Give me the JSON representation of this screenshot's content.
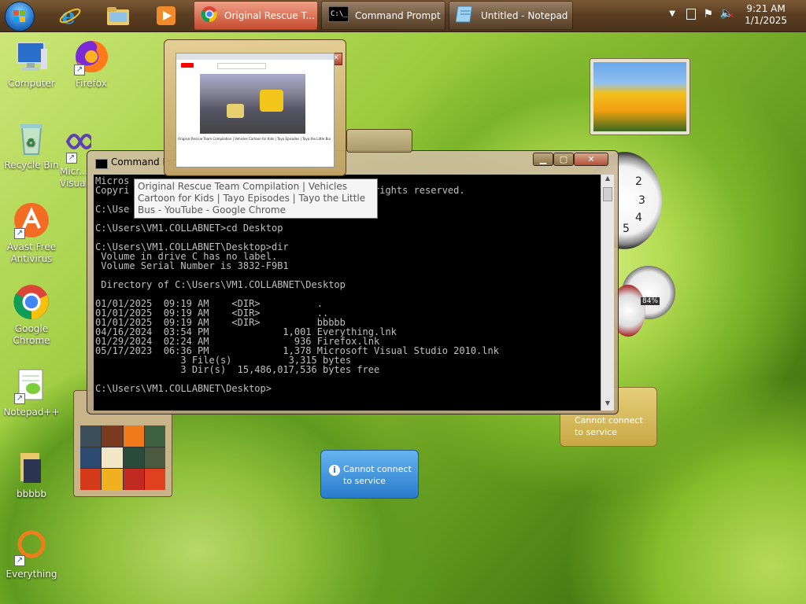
{
  "taskbar": {
    "tasks": [
      {
        "label": "Original Rescue T...",
        "icon": "chrome-icon",
        "active": true
      },
      {
        "label": "Command Prompt",
        "icon": "cmd-icon"
      },
      {
        "label": "Untitled - Notepad",
        "icon": "notepad-icon"
      }
    ],
    "clock": {
      "time": "9:21 AM",
      "date": "1/1/2025"
    }
  },
  "desktop_icons": [
    {
      "label": "Computer",
      "icon": "computer-icon"
    },
    {
      "label": "Firefox",
      "icon": "firefox-icon"
    },
    {
      "label": "Recycle Bin",
      "icon": "recycle-bin-icon"
    },
    {
      "label": "Micr... Visua...",
      "icon": "visual-studio-icon"
    },
    {
      "label": "Avast Free Antivirus",
      "icon": "avast-icon"
    },
    {
      "label": "Google Chrome",
      "icon": "chrome-icon"
    },
    {
      "label": "Notepad++",
      "icon": "notepadpp-icon"
    },
    {
      "label": "bbbbb",
      "icon": "folder-icon"
    },
    {
      "label": "Everything",
      "icon": "everything-icon"
    }
  ],
  "cmd_window": {
    "title": "Command Prompt",
    "lines": [
      "Micros",
      "Copyri                                         l rights reserved.",
      "",
      "C:\\Use",
      "",
      "C:\\Users\\VM1.COLLABNET>cd Desktop",
      "",
      "C:\\Users\\VM1.COLLABNET\\Desktop>dir",
      " Volume in drive C has no label.",
      " Volume Serial Number is 3832-F9B1",
      "",
      " Directory of C:\\Users\\VM1.COLLABNET\\Desktop",
      "",
      "01/01/2025  09:19 AM    <DIR>          .",
      "01/01/2025  09:19 AM    <DIR>          ..",
      "01/01/2025  09:19 AM    <DIR>          bbbbb",
      "04/16/2024  03:54 PM             1,001 Everything.lnk",
      "01/29/2024  02:24 AM               936 Firefox.lnk",
      "05/17/2023  06:36 PM             1,378 Microsoft Visual Studio 2010.lnk",
      "               3 File(s)          3,315 bytes",
      "               3 Dir(s)  15,486,017,536 bytes free",
      "",
      "C:\\Users\\VM1.COLLABNET\\Desktop>"
    ]
  },
  "thumbnail_title": "Original Rescue Team Compilation | Vehicles Cartoon for Kids | Tayo Episodes | Tayo the Little Bus",
  "tooltip": "Original Rescue Team Compilation | Vehicles Cartoon for Kids | Tayo Episodes | Tayo the Little Bus - YouTube - Google Chrome",
  "gadgets": {
    "weather_msg": "Cannot connect to service",
    "feed_msg": "Cannot connect to service",
    "meter_label": "84%"
  },
  "colors": {
    "taskbar": "#5b3f22",
    "console_bg": "#000000",
    "console_text": "#c0c0c0",
    "gadget_blue": "#3b8fd0"
  }
}
